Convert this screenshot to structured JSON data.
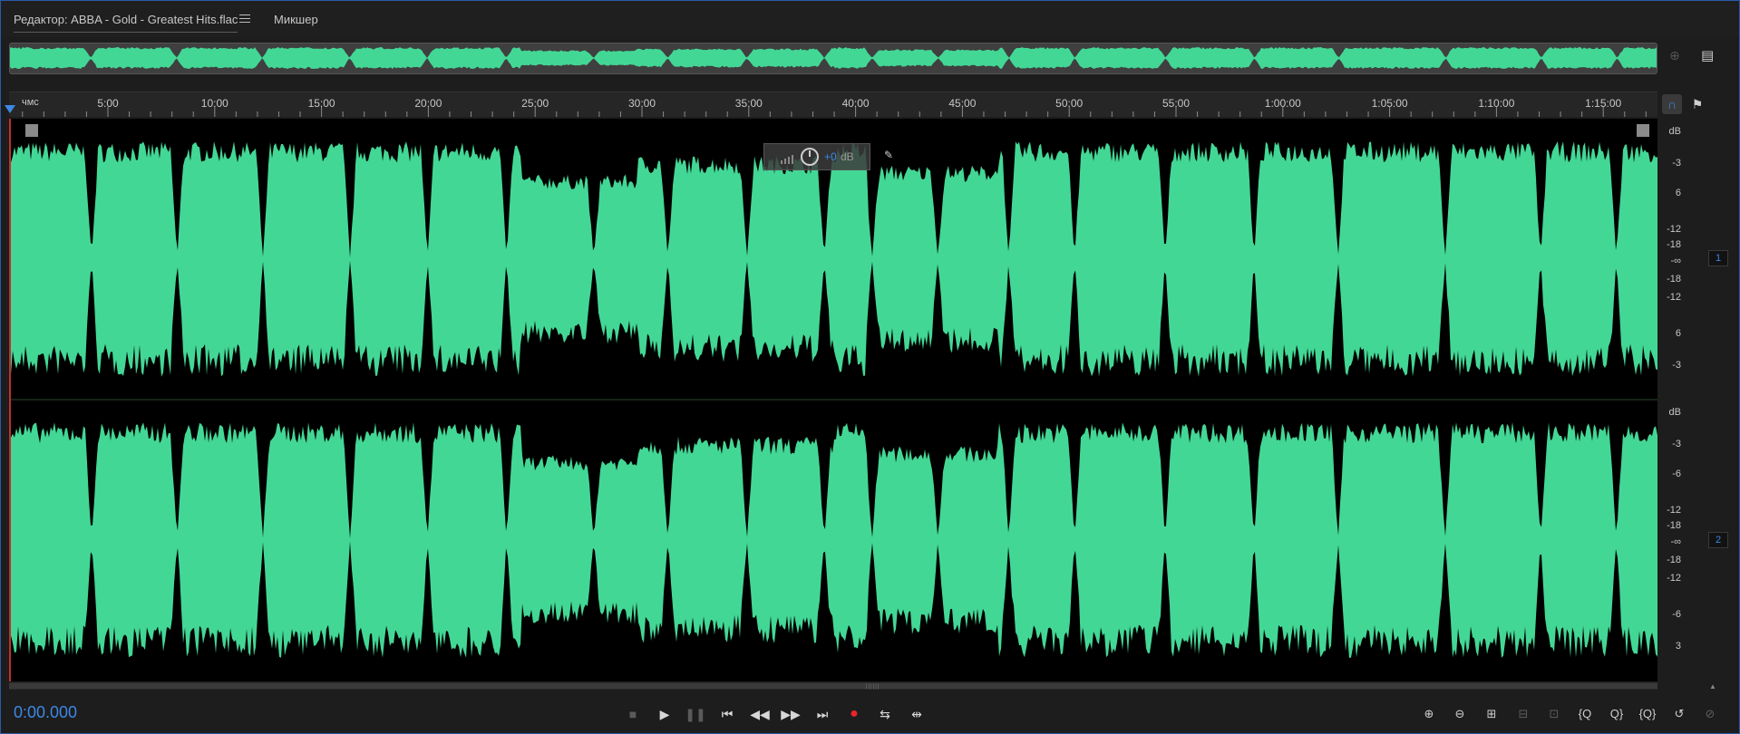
{
  "tabs": {
    "editor_label": "Редактор: ABBA - Gold - Greatest Hits.flac",
    "mixer_label": "Микшер"
  },
  "ruler": {
    "units_label": "чмс",
    "ticks": [
      "5:00",
      "10:00",
      "15:00",
      "20:00",
      "25:00",
      "30:00",
      "35:00",
      "40:00",
      "45:00",
      "50:00",
      "55:00",
      "1:00:00",
      "1:05:00",
      "1:10:00",
      "1:15:00"
    ]
  },
  "hud": {
    "volume_value": "+0",
    "volume_unit": "dB"
  },
  "db_scale": {
    "channel1": [
      "dB",
      "-3",
      "6",
      "-12",
      "-18",
      "-∞",
      "-18",
      "-12",
      "6",
      "-3"
    ],
    "channel2": [
      "dB",
      "-3",
      "-6",
      "-12",
      "-18",
      "-∞",
      "-18",
      "-12",
      "-6",
      "3"
    ]
  },
  "channels": [
    "1",
    "2"
  ],
  "transport": {
    "time": "0:00.000"
  },
  "colors": {
    "waveform": "#43d795",
    "accent": "#3d87e6",
    "record": "#e8262b",
    "background": "#1d1d1d"
  },
  "icons": {
    "transport": [
      "stop-icon",
      "play-icon",
      "pause-icon",
      "skip-to-start-icon",
      "rewind-icon",
      "fast-forward-icon",
      "skip-to-end-icon",
      "record-icon",
      "loop-icon",
      "skip-selection-icon"
    ],
    "zoom": [
      "zoom-in-amplitude-icon",
      "zoom-out-amplitude-icon",
      "zoom-in-time-icon",
      "zoom-out-full-icon",
      "zoom-selection-icon",
      "zoom-in-left-icon",
      "zoom-in-right-icon",
      "zoom-out-both-icon",
      "zoom-reset-icon",
      "zoom-frequency-icon"
    ]
  }
}
